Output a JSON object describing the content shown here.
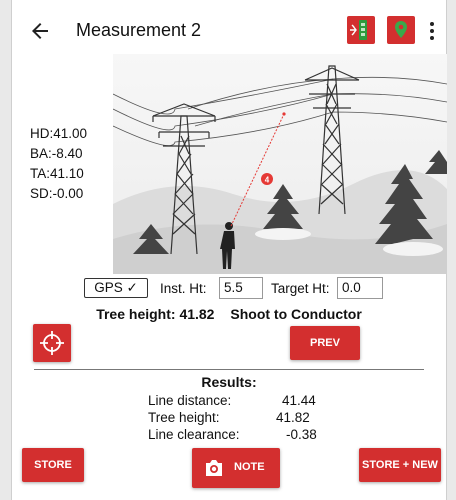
{
  "app": {
    "title": "Measurement 2",
    "accent": "#d32f2f"
  },
  "icons": {
    "back": "arrow-left-icon",
    "laser": "laser-device-icon",
    "location": "map-pin-icon",
    "more": "more-vert-icon",
    "crosshair": "crosshair-icon",
    "camera": "camera-icon"
  },
  "readings": [
    {
      "label": "HD:",
      "value": "41.00"
    },
    {
      "label": "BA:",
      "value": "-8.40"
    },
    {
      "label": "TA:",
      "value": "41.10"
    },
    {
      "label": "SD:",
      "value": "-0.00"
    }
  ],
  "scene": {
    "marker": "4"
  },
  "controls": {
    "gps_label": "GPS ✓",
    "inst_ht_label": "Inst. Ht:",
    "inst_ht_value": "5.5",
    "target_ht_label": "Target Ht:",
    "target_ht_value": "0.0"
  },
  "status": {
    "tree_height": "Tree height: 41.82",
    "mode": "Shoot to Conductor"
  },
  "buttons": {
    "prev": "PREV",
    "store": "STORE",
    "note": "NOTE",
    "store_new": "STORE + NEW"
  },
  "results": {
    "title": "Results:",
    "rows": [
      {
        "label": "Line distance:",
        "value": "41.44"
      },
      {
        "label": "Tree height:",
        "value": "41.82"
      },
      {
        "label": "Line clearance:",
        "value": "-0.38"
      }
    ]
  }
}
